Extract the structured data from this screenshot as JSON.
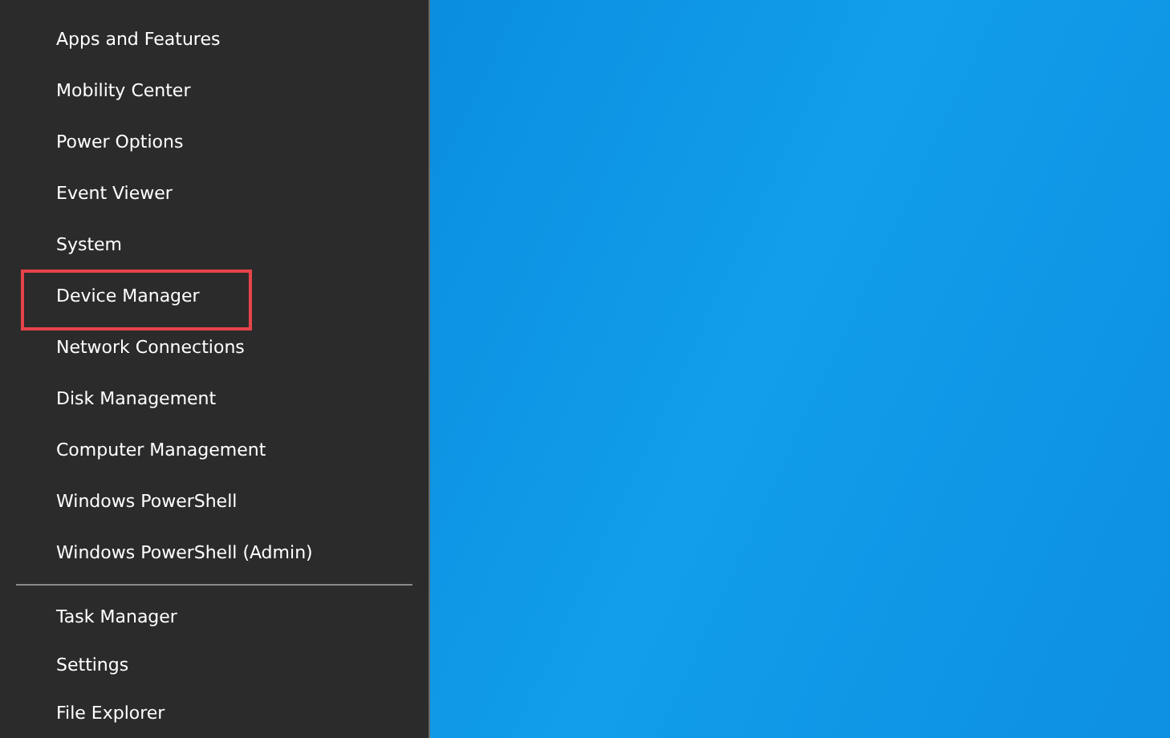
{
  "menu": {
    "groups": [
      {
        "items": [
          {
            "label": "Apps and Features",
            "highlighted": false
          },
          {
            "label": "Mobility Center",
            "highlighted": false
          },
          {
            "label": "Power Options",
            "highlighted": false
          },
          {
            "label": "Event Viewer",
            "highlighted": false
          },
          {
            "label": "System",
            "highlighted": false
          },
          {
            "label": "Device Manager",
            "highlighted": true
          },
          {
            "label": "Network Connections",
            "highlighted": false
          },
          {
            "label": "Disk Management",
            "highlighted": false
          },
          {
            "label": "Computer Management",
            "highlighted": false
          },
          {
            "label": "Windows PowerShell",
            "highlighted": false
          },
          {
            "label": "Windows PowerShell (Admin)",
            "highlighted": false
          }
        ]
      },
      {
        "items": [
          {
            "label": "Task Manager",
            "highlighted": false
          },
          {
            "label": "Settings",
            "highlighted": false
          },
          {
            "label": "File Explorer",
            "highlighted": false
          }
        ]
      }
    ]
  }
}
